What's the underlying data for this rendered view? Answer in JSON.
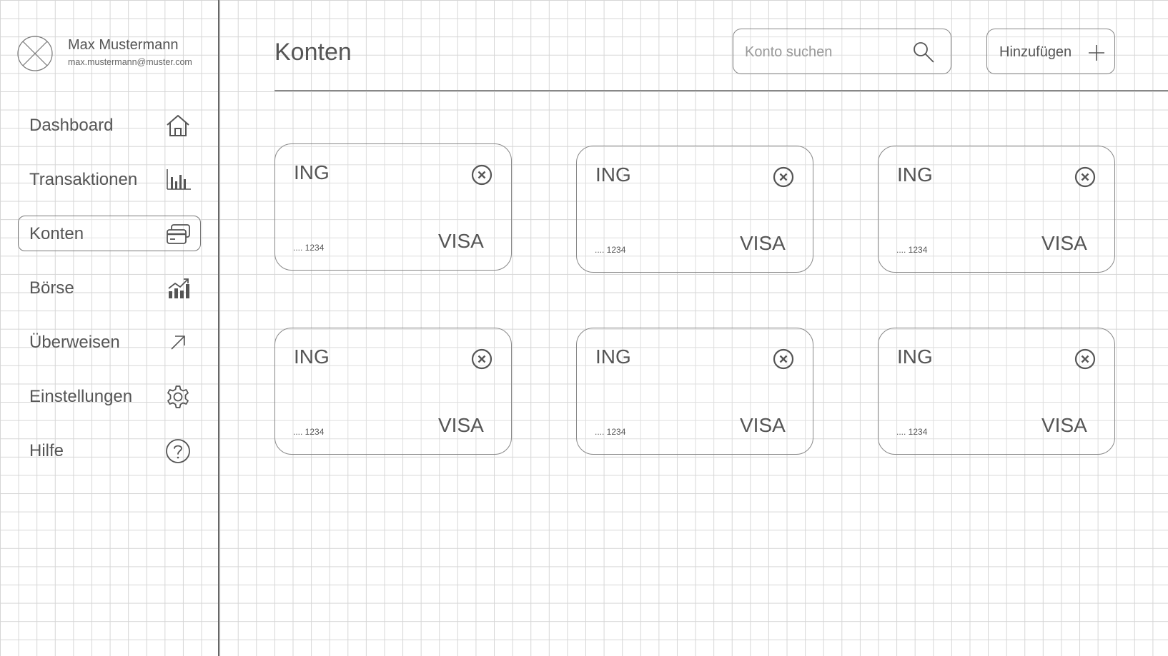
{
  "user": {
    "name": "Max Mustermann",
    "email": "max.mustermann@muster.com"
  },
  "sidebar": {
    "items": [
      {
        "label": "Dashboard",
        "icon": "home-icon",
        "active": false
      },
      {
        "label": "Transaktionen",
        "icon": "bar-chart-icon",
        "active": false
      },
      {
        "label": "Konten",
        "icon": "credit-cards-icon",
        "active": true
      },
      {
        "label": "Börse",
        "icon": "stock-chart-icon",
        "active": false
      },
      {
        "label": "Überweisen",
        "icon": "arrow-up-right-icon",
        "active": false
      },
      {
        "label": "Einstellungen",
        "icon": "gear-icon",
        "active": false
      },
      {
        "label": "Hilfe",
        "icon": "help-circle-icon",
        "active": false
      }
    ]
  },
  "header": {
    "title": "Konten",
    "search_placeholder": "Konto suchen",
    "search_value": "",
    "add_label": "Hinzufügen"
  },
  "accounts": [
    {
      "bank": "ING",
      "number": ".... 1234",
      "brand": "VISA"
    },
    {
      "bank": "ING",
      "number": ".... 1234",
      "brand": "VISA"
    },
    {
      "bank": "ING",
      "number": ".... 1234",
      "brand": "VISA"
    },
    {
      "bank": "ING",
      "number": ".... 1234",
      "brand": "VISA"
    },
    {
      "bank": "ING",
      "number": ".... 1234",
      "brand": "VISA"
    },
    {
      "bank": "ING",
      "number": ".... 1234",
      "brand": "VISA"
    }
  ],
  "colors": {
    "grid": "#d6d6d6",
    "stroke": "#888888",
    "text": "#555555",
    "divider": "#666666"
  }
}
